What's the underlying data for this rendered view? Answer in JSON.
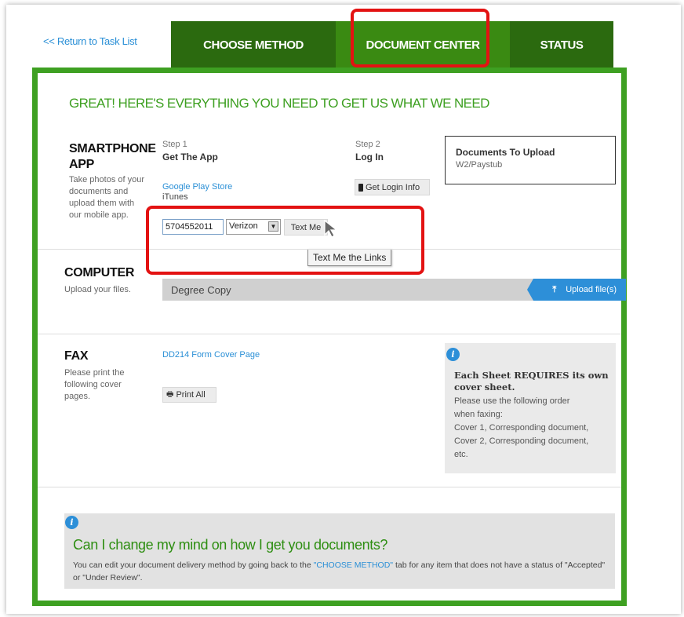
{
  "nav": {
    "return_link": "<< Return to Task List",
    "tabs": [
      "CHOOSE METHOD",
      "DOCUMENT CENTER",
      "STATUS"
    ]
  },
  "headline": "GREAT! HERE'S EVERYTHING YOU NEED TO GET US WHAT WE NEED",
  "smartphone": {
    "title_line1": "SMARTPHONE",
    "title_line2": "APP",
    "description": [
      "Take photos of your",
      "documents and",
      "upload them with",
      "our mobile app."
    ],
    "step1_label": "Step 1",
    "step1_title": "Get The App",
    "google_play_link": "Google Play Store",
    "itunes_link": "iTunes",
    "step2_label": "Step 2",
    "step2_title": "Log In",
    "login_button": "Get Login Info",
    "phone_value": "5704552011",
    "carrier_value": "Verizon",
    "text_me_button": "Text Me",
    "tooltip": "Text Me the Links",
    "docs_box_title": "Documents To Upload",
    "docs_box_item": "W2/Paystub"
  },
  "computer": {
    "title": "COMPUTER",
    "description": "Upload your files.",
    "file_name": "Degree Copy",
    "upload_button": "Upload file(s)"
  },
  "fax": {
    "title": "FAX",
    "description": [
      "Please print the",
      "following cover",
      "pages."
    ],
    "cover_link": "DD214 Form Cover Page",
    "print_button": "Print All",
    "info_title_line1": "Each Sheet REQUIRES its own",
    "info_title_line2": "cover sheet.",
    "info_lines": [
      "Please use the following order",
      "when faxing:",
      "Cover 1, Corresponding document,",
      "Cover 2, Corresponding document,",
      "etc."
    ]
  },
  "faq": {
    "title": "Can I change my mind on how I get you documents?",
    "text_before": "You can edit your document delivery method by going back to the ",
    "text_link": "\"CHOOSE METHOD\"",
    "text_after": " tab for any item that does not have a status of \"Accepted\" or \"Under Review\"."
  },
  "colors": {
    "tab_green": "#2b6a0f",
    "border_green": "#3ea022",
    "link_blue": "#2a8fd6",
    "highlight_red": "#e31212"
  }
}
